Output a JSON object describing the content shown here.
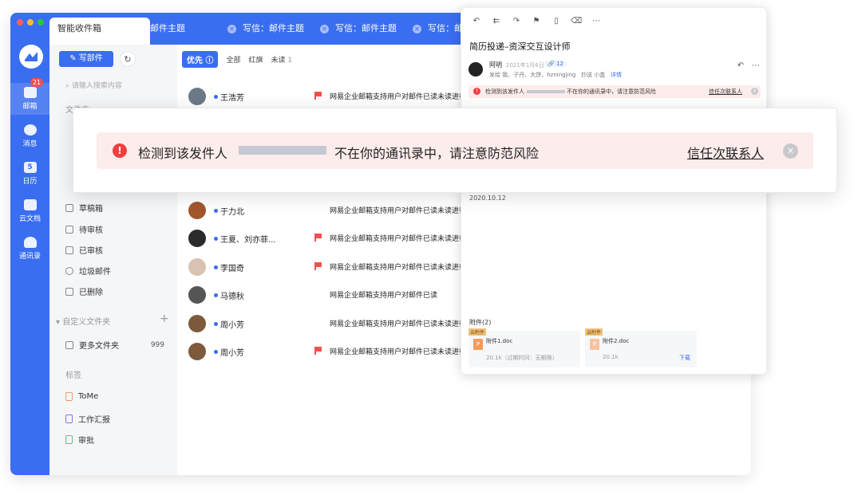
{
  "tabs": [
    {
      "label": "智能收件箱"
    },
    {
      "label": "邮件主题"
    },
    {
      "label": "写信：邮件主题"
    },
    {
      "label": "写信：邮件主题"
    },
    {
      "label": "写信：邮件主题"
    }
  ],
  "rail": {
    "mail_badge": "21",
    "items": [
      {
        "label": "邮箱",
        "icon": "mail-icon"
      },
      {
        "label": "消息",
        "icon": "chat-icon"
      },
      {
        "label": "日历",
        "icon": "calendar-icon",
        "day": "5"
      },
      {
        "label": "云文档",
        "icon": "cloud-doc-icon"
      },
      {
        "label": "通讯录",
        "icon": "contacts-icon"
      }
    ]
  },
  "sidebar": {
    "compose_label": "写部件",
    "search_placeholder": "请输入搜索内容",
    "folders_section": "文件夹",
    "folders": [
      {
        "label": "草稿箱"
      },
      {
        "label": "待审核"
      },
      {
        "label": "已审核"
      },
      {
        "label": "垃圾邮件"
      },
      {
        "label": "已删除"
      }
    ],
    "custom_section": "自定义文件夹",
    "custom_folders": [
      {
        "label": "更多文件夹",
        "count": "999"
      }
    ],
    "tags_section": "标签",
    "tags": [
      {
        "label": "ToMe",
        "color": "#f29b5a"
      },
      {
        "label": "工作汇报",
        "color": "#8b6ee8"
      },
      {
        "label": "审批",
        "color": "#4cc98a"
      }
    ]
  },
  "filters": {
    "priority": "优先",
    "all": "全部",
    "flagged": "红旗",
    "unread": "未读",
    "unread_count": "1"
  },
  "mails": [
    {
      "sender": "王浩芳",
      "subject": "网易企业邮箱支持用户对邮件已读未读进行",
      "flag": true,
      "avatar_color": "#6b7a87"
    },
    {
      "sender": "于力北",
      "subject": "网易企业邮箱支持用户对邮件已读未读进行",
      "flag": false,
      "avatar_color": "#a2562e"
    },
    {
      "sender": "王夏、刘亦菲...",
      "subject": "网易企业邮箱支持用户对邮件已读未读进行",
      "flag": true,
      "avatar_color": "#2b2b2b"
    },
    {
      "sender": "李国奇",
      "subject": "网易企业邮箱支持用户对邮件已读未读进行",
      "flag": true,
      "avatar_color": "#d8c3b0"
    },
    {
      "sender": "马德秋",
      "subject": "网易企业邮箱支持用户对邮件已读",
      "flag": false,
      "avatar_color": "#555555"
    },
    {
      "sender": "周小芳",
      "subject": "网易企业邮箱支持用户对邮件已读未读进行",
      "flag": false,
      "avatar_color": "#7d5a3c"
    },
    {
      "sender": "周小芳",
      "subject": "网易企业邮箱支持用户对邮件已读未读进行",
      "flag": true,
      "avatar_color": "#7d5a3c"
    }
  ],
  "reader": {
    "title": "简历投递–资深交互设计师",
    "sender": "阿明",
    "date": "2021年1月6日",
    "attach_count": "12",
    "recipients": "发给 我、子丹、大饼、hzningjing",
    "cc": "抄送 小盒",
    "details_link": "详情",
    "warn_prefix": "检测到该发件人",
    "warn_suffix": "不在你的通讯录中，请注意防范风险",
    "warn_link": "信任次联系人",
    "body_date": "2020.10.12",
    "attachments_label": "附件(2)",
    "attachments": [
      {
        "tag": "云附件",
        "name": "附件1.doc",
        "size": "20.1k（过期时间：无期限）",
        "download": ""
      },
      {
        "tag": "云附件",
        "name": "附件2.doc",
        "size": "20.1k",
        "download": "下载"
      }
    ]
  },
  "banner": {
    "prefix": "检测到该发件人",
    "suffix": "不在你的通讯录中，请注意防范风险",
    "link": "信任次联系人"
  }
}
